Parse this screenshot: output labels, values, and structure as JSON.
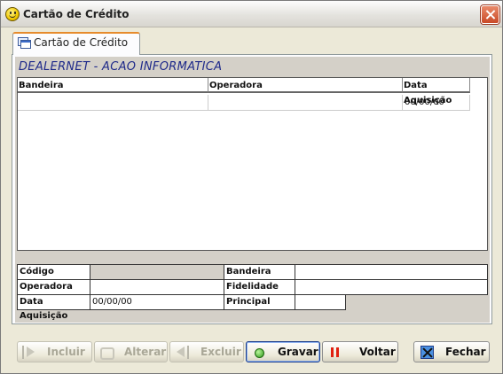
{
  "window": {
    "title": "Cartão de Crédito"
  },
  "tab": {
    "label": "Cartão de Crédito"
  },
  "company": "DEALERNET - ACAO INFORMATICA",
  "grid": {
    "columns": [
      "Bandeira",
      "Operadora",
      "Data Aquisição"
    ],
    "rows": [
      {
        "bandeira": "",
        "operadora": "",
        "data_aquisicao": "00/00/00"
      }
    ]
  },
  "form": {
    "codigo_label": "Código",
    "codigo_value": "",
    "bandeira_label": "Bandeira",
    "bandeira_value": "",
    "operadora_label": "Operadora",
    "operadora_value": "",
    "fidelidade_label": "Fidelidade",
    "fidelidade_value": "",
    "data_aquisicao_label": "Data Aquisição",
    "data_aquisicao_value": "00/00/00",
    "principal_label": "Principal",
    "principal_value": ""
  },
  "buttons": {
    "incluir": "Incluir",
    "alterar": "Alterar",
    "excluir": "Excluir",
    "gravar": "Gravar",
    "voltar": "Voltar",
    "fechar": "Fechar"
  },
  "icons": {
    "incluir": "arrow-right-icon",
    "alterar": "refresh-icon",
    "excluir": "arrow-left-icon",
    "gravar": "green-dot-icon",
    "voltar": "pause-icon",
    "fechar": "close-x-icon"
  }
}
